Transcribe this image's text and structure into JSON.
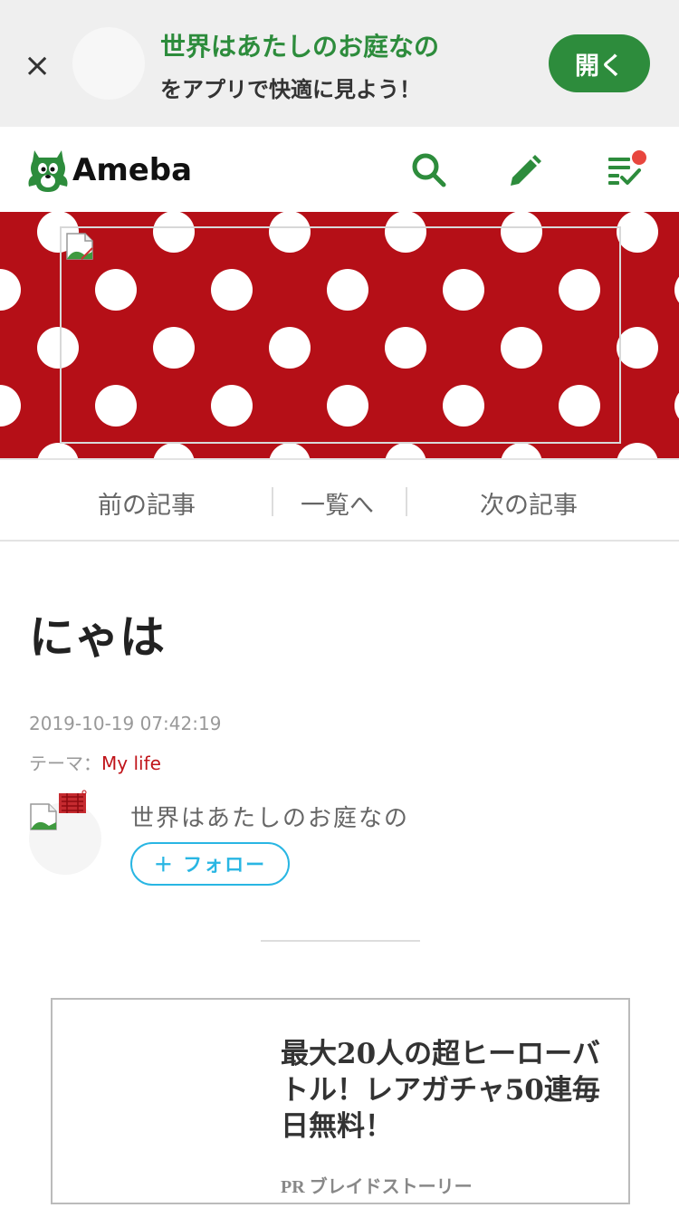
{
  "app_banner": {
    "close_glyph": "×",
    "title": "世界はあたしのお庭なの",
    "subtitle": "をアプリで快適に見よう！",
    "open_label": "開く"
  },
  "header": {
    "logo_text": "Ameba",
    "icons": [
      "search-icon",
      "pencil-icon",
      "checklist-icon"
    ],
    "accent_color": "#2d8c3c",
    "notification_color": "#e8463e"
  },
  "hero": {
    "background_color": "#b50f17",
    "pattern": "white-polka-dots"
  },
  "article_nav": {
    "prev_label": "前の記事",
    "list_label": "一覧へ",
    "next_label": "次の記事"
  },
  "entry": {
    "title": "にゃは",
    "date": "2019-10-19 07:42:19",
    "theme_prefix": "テーマ：",
    "theme_name": "My life"
  },
  "author": {
    "name": "世界はあたしのお庭なの",
    "follow_label": "＋ フォロー",
    "follow_color": "#29b6e3"
  },
  "ad": {
    "title": "最大20人の超ヒーローバトル！レアガチャ50連毎日無料！",
    "sponsor": "PR ブレイドストーリー"
  }
}
